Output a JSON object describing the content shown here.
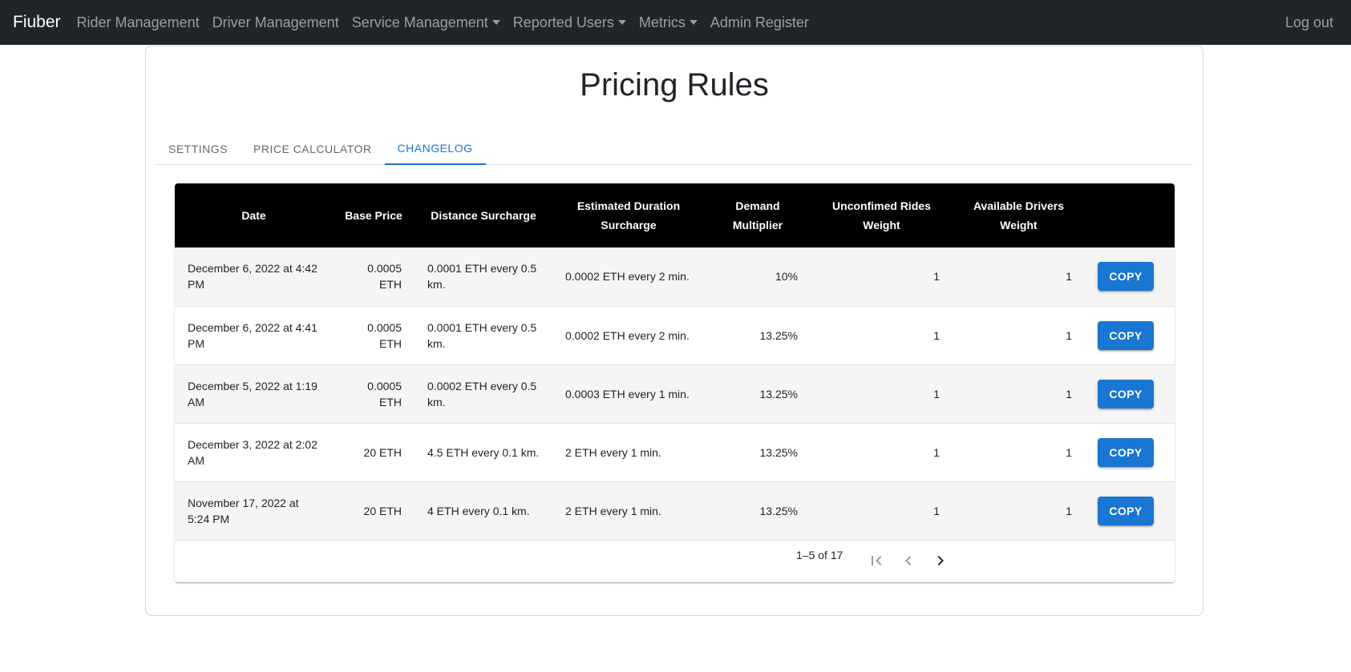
{
  "navbar": {
    "brand": "Fiuber",
    "items": [
      {
        "label": "Rider Management"
      },
      {
        "label": "Driver Management"
      },
      {
        "label": "Service Management"
      },
      {
        "label": "Reported Users"
      },
      {
        "label": "Metrics"
      },
      {
        "label": "Admin Register"
      }
    ],
    "logout": "Log out"
  },
  "page": {
    "title": "Pricing Rules"
  },
  "tabs": [
    {
      "label": "SETTINGS"
    },
    {
      "label": "PRICE CALCULATOR"
    },
    {
      "label": "CHANGELOG"
    }
  ],
  "table": {
    "headers": [
      "Date",
      "Base Price",
      "Distance Surcharge",
      "Estimated Duration Surcharge",
      "Demand Multiplier",
      "Unconfimed Rides Weight",
      "Available Drivers Weight"
    ],
    "copy_label": "COPY",
    "rows": [
      {
        "date": "December 6, 2022 at 4:42 PM",
        "base": "0.0005 ETH",
        "distance": "0.0001 ETH every 0.5 km.",
        "duration": "0.0002 ETH every 2 min.",
        "demand": "10%",
        "unconfirmed": "1",
        "drivers": "1"
      },
      {
        "date": "December 6, 2022 at 4:41 PM",
        "base": "0.0005 ETH",
        "distance": "0.0001 ETH every 0.5 km.",
        "duration": "0.0002 ETH every 2 min.",
        "demand": "13.25%",
        "unconfirmed": "1",
        "drivers": "1"
      },
      {
        "date": "December 5, 2022 at 1:19 AM",
        "base": "0.0005 ETH",
        "distance": "0.0002 ETH every 0.5 km.",
        "duration": "0.0003 ETH every 1 min.",
        "demand": "13.25%",
        "unconfirmed": "1",
        "drivers": "1"
      },
      {
        "date": "December 3, 2022 at 2:02 AM",
        "base": "20 ETH",
        "distance": "4.5 ETH every 0.1 km.",
        "duration": "2 ETH every 1 min.",
        "demand": "13.25%",
        "unconfirmed": "1",
        "drivers": "1"
      },
      {
        "date": "November 17, 2022 at 5:24 PM",
        "base": "20 ETH",
        "distance": "4 ETH every 0.1 km.",
        "duration": "2 ETH every 1 min.",
        "demand": "13.25%",
        "unconfirmed": "1",
        "drivers": "1"
      }
    ]
  },
  "pagination": {
    "info": "1–5 of 17"
  },
  "icons": {
    "first_page": "first-page-icon",
    "prev_page": "chevron-left-icon",
    "next_page": "chevron-right-icon"
  },
  "colors": {
    "navbar_bg": "#212529",
    "accent": "#1976d2",
    "table_header_bg": "#000000"
  }
}
